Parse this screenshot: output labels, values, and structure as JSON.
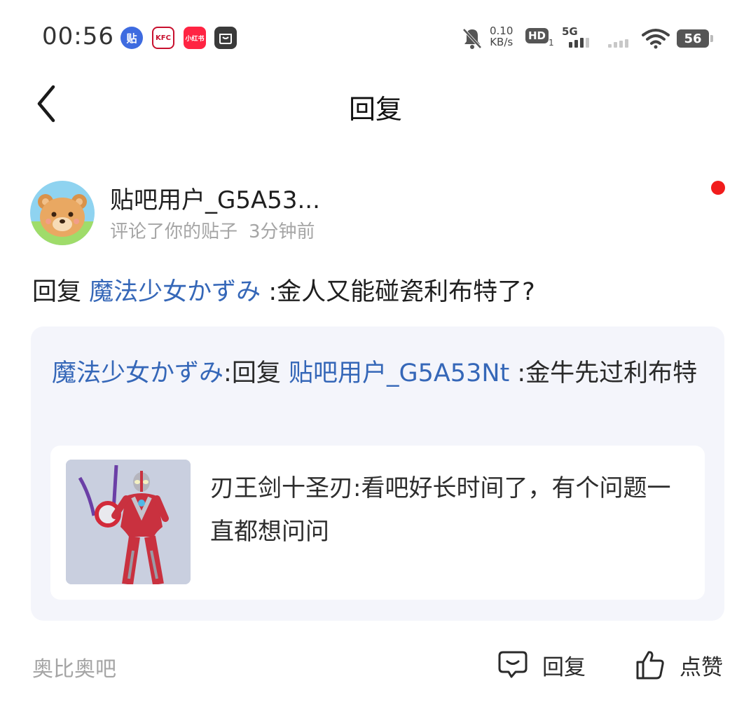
{
  "status_bar": {
    "time": "00:56",
    "app_icons": [
      {
        "name": "tieba-icon",
        "glyph": "贴"
      },
      {
        "name": "kfc-icon",
        "glyph": "KFC"
      },
      {
        "name": "xiaohongshu-icon",
        "glyph": "小红书"
      },
      {
        "name": "shopping-bag-icon",
        "glyph": ""
      }
    ],
    "net_speed_value": "0.10",
    "net_speed_unit": "KB/s",
    "hd_label": "HD",
    "hd_sub": "1",
    "network_label": "5G",
    "battery": "56"
  },
  "header": {
    "title": "回复"
  },
  "notification": {
    "username": "贴吧用户_G5A53...",
    "action_text": "评论了你的贴子",
    "time_ago": "3分钟前",
    "reply_prefix": "回复",
    "reply_target": "魔法少女かずみ",
    "reply_content": ":金人又能碰瓷利布特了?"
  },
  "quote": {
    "author": "魔法少女かずみ",
    "separator": ":",
    "reply_prefix": "回复",
    "reply_target": "贴吧用户_G5A53Nt",
    "content": ":金牛先过利布特"
  },
  "original_post": {
    "author": "刃王剑十圣刃",
    "separator": ":",
    "content": "看吧好长时间了，有个问题一直都想问问"
  },
  "footer": {
    "forum_name": "奥比奥吧",
    "reply_label": "回复",
    "like_label": "点赞"
  },
  "colors": {
    "link": "#3567b8",
    "unread_dot": "#f11c1c",
    "card_bg": "#f4f5fb",
    "muted_text": "#a5a5a5"
  }
}
